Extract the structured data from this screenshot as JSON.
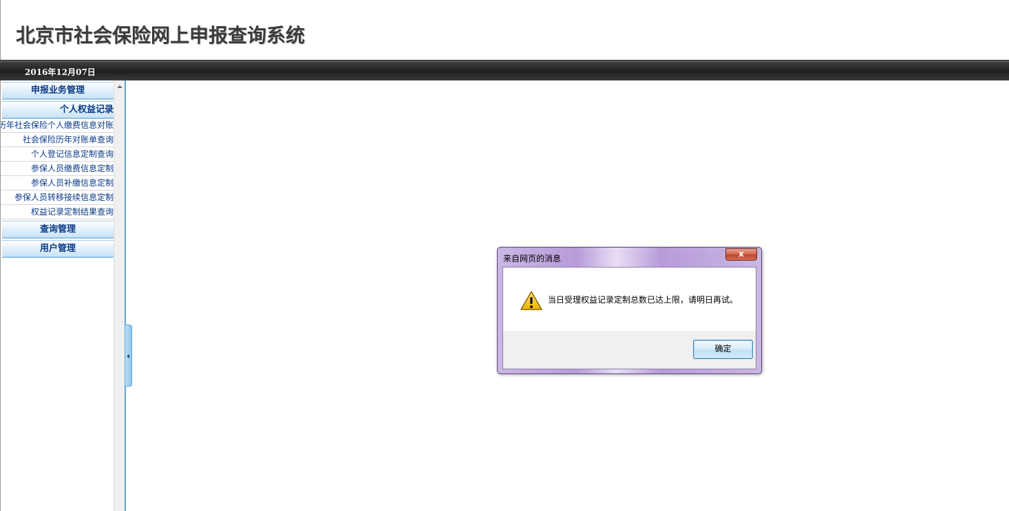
{
  "header": {
    "title": "北京市社会保险网上申报查询系统"
  },
  "datebar": {
    "date": "2016年12月07日"
  },
  "sidebar": {
    "menus": [
      {
        "label": "申报业务管理"
      },
      {
        "label": "个人权益记录"
      },
      {
        "label": "查询管理"
      },
      {
        "label": "用户管理"
      }
    ],
    "items": [
      {
        "label": "历年社会保险个人缴费信息对账"
      },
      {
        "label": "社会保险历年对账单查询"
      },
      {
        "label": "个人登记信息定制查询"
      },
      {
        "label": "参保人员缴费信息定制"
      },
      {
        "label": "参保人员补缴信息定制"
      },
      {
        "label": "参保人员转移接续信息定制"
      },
      {
        "label": "权益记录定制结果查询"
      }
    ]
  },
  "dialog": {
    "title": "来自网页的消息",
    "close_label": "x",
    "message": "当日受理权益记录定制总数已达上限，请明日再试。",
    "ok_label": "确定"
  },
  "colors": {
    "menu_text": "#0b3a86",
    "splitter": "#5ea6d8",
    "datebar": "#1e1e1e"
  }
}
